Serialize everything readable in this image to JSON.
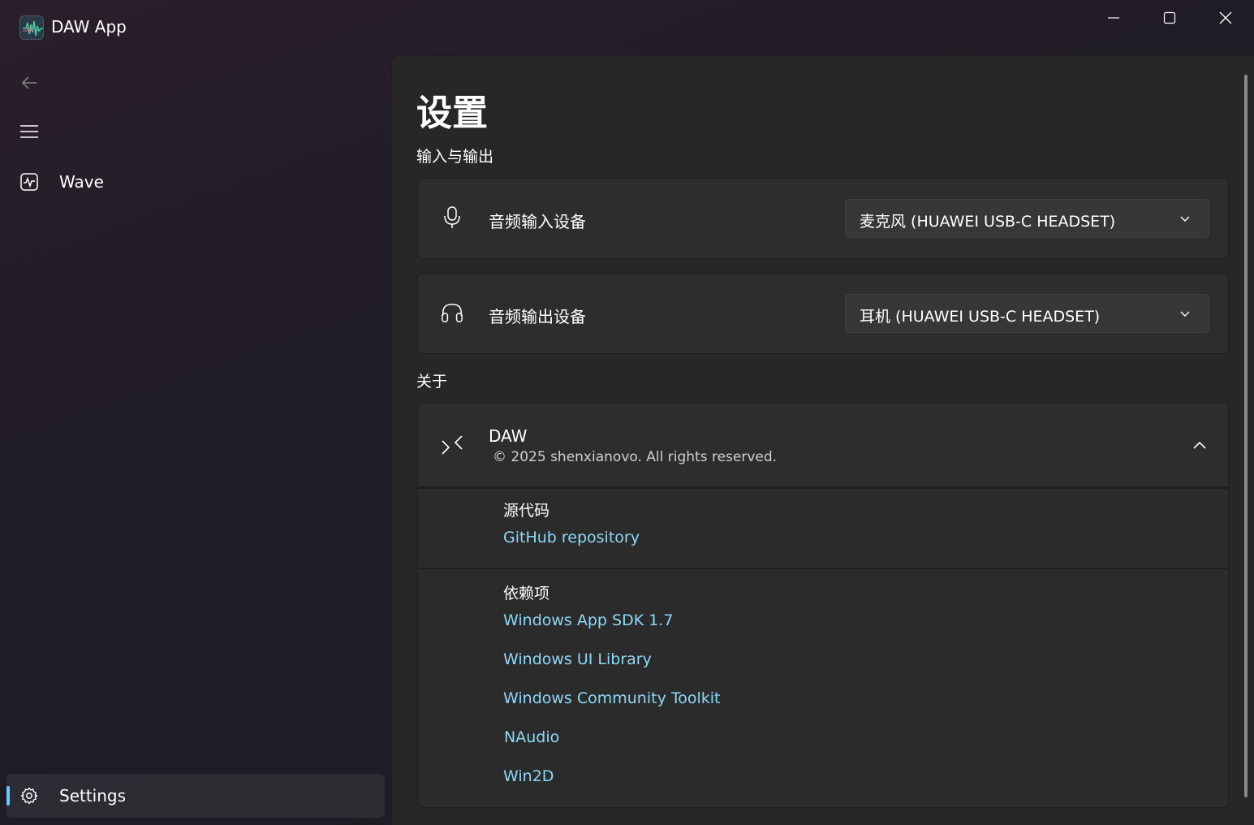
{
  "window": {
    "title": "DAW App"
  },
  "nav": {
    "items": [
      {
        "label": "Wave",
        "icon": "wave-icon"
      },
      {
        "label": "Settings",
        "icon": "gear-icon"
      }
    ]
  },
  "page": {
    "title": "设置",
    "io_section": {
      "header": "输入与输出",
      "input": {
        "label": "音频输入设备",
        "icon": "microphone-icon",
        "value": "麦克风 (HUAWEI USB-C HEADSET)"
      },
      "output": {
        "label": "音频输出设备",
        "icon": "headphones-icon",
        "value": "耳机 (HUAWEI USB-C HEADSET)"
      }
    },
    "about_section": {
      "header": "关于",
      "app_name": "DAW",
      "copyright": "© 2025 shenxianovo. All rights reserved.",
      "source_heading": "源代码",
      "source_link": "GitHub repository",
      "deps_heading": "依赖项",
      "deps": [
        "Windows App SDK 1.7",
        "Windows UI Library",
        "Windows Community Toolkit",
        "NAudio",
        "Win2D"
      ]
    }
  },
  "colors": {
    "accent": "#60cdff",
    "link": "#8fd8f8",
    "content_bg": "#272727",
    "card_bg": "#2d2d2d"
  }
}
